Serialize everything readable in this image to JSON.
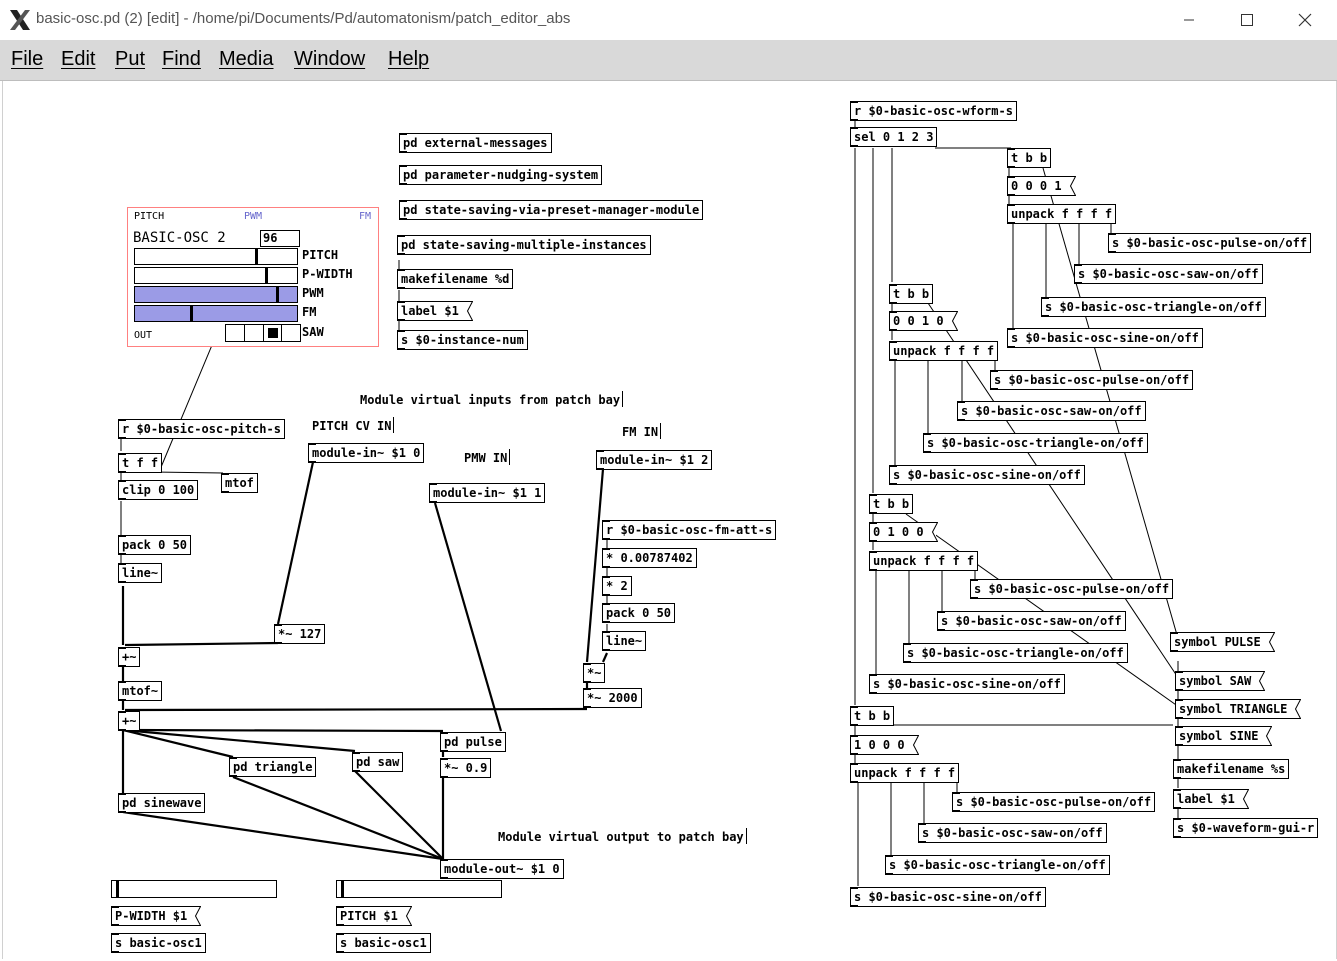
{
  "window": {
    "title": "basic-osc.pd  (2) [edit] - /home/pi/Documents/Pd/automatonism/patch_editor_abs",
    "icon": "x-window-icon",
    "controls": [
      "minimize-icon",
      "maximize-icon",
      "close-icon"
    ]
  },
  "menu": [
    "File",
    "Edit",
    "Put",
    "Find",
    "Media",
    "Window",
    "Help"
  ],
  "gui": {
    "top_labels": {
      "pitch": "PITCH",
      "pwm": "PWM",
      "fm": "FM"
    },
    "title": "BASIC-OSC 2",
    "number_box": "96",
    "rows": [
      "PITCH",
      "P-WIDTH",
      "PWM",
      "FM",
      "SAW"
    ],
    "out_label": "OUT",
    "slider_levels": [
      0.76,
      0.82,
      0.89,
      0.35
    ],
    "waveform_selected": 2,
    "colors": {
      "border": "#ff8080",
      "active_fill": "#9b9be6",
      "pwm_label": "#6666cc"
    }
  },
  "comments": {
    "inputs": "Module virtual inputs from patch bay",
    "pitch_cv": "PITCH CV IN",
    "pmw": "PMW IN",
    "fm": "FM IN",
    "output": "Module virtual output to patch bay"
  },
  "objects": {
    "ext_messages": "pd external-messages",
    "nudging": "pd parameter-nudging-system",
    "preset": "pd state-saving-via-preset-manager-module",
    "multi": "pd state-saving-multiple-instances",
    "mkfile1": "makefilename %d",
    "label1": "label $1",
    "instance": "s $0-instance-num",
    "pitch_r": "r $0-basic-osc-pitch-s",
    "tff": "t f f",
    "mtof1": "mtof",
    "clip": "clip 0 100",
    "pack1": "pack 0 50",
    "line1": "line~",
    "modin_pitch": "module-in~ $1 0",
    "mul127": "*~ 127",
    "add1": "+~",
    "mtof2": "mtof~",
    "add2": "+~",
    "modin_pwm": "module-in~ $1 1",
    "modin_fm": "module-in~ $1 2",
    "fm_att": "r $0-basic-osc-fm-att-s",
    "mul_small": "* 0.00787402",
    "mul2": "* 2",
    "pack2": "pack 0 50",
    "line2": "line~",
    "mulsig": "*~",
    "mul2000": "*~ 2000",
    "pd_triangle": "pd triangle",
    "pd_saw": "pd saw",
    "pd_pulse": "pd pulse",
    "mul09": "*~ 0.9",
    "pd_sinewave": "pd sinewave",
    "modout": "module-out~ $1 0",
    "pwidth_msg": "P-WIDTH $1",
    "s_osc1_a": "s basic-osc1",
    "pitch_msg": "PITCH $1",
    "s_osc1_b": "s basic-osc1",
    "wform_r": "r $0-basic-osc-wform-s",
    "sel": "sel 0 1 2 3",
    "tbb1": "t b b",
    "msg0001": "0 0 0 1",
    "unpack1": "unpack f f f f",
    "s_pulse1": "s $0-basic-osc-pulse-on/off",
    "s_saw1": "s $0-basic-osc-saw-on/off",
    "s_tri1": "s $0-basic-osc-triangle-on/off",
    "s_sine1": "s $0-basic-osc-sine-on/off",
    "tbb2": "t b b",
    "msg0010": "0 0 1 0",
    "unpack2": "unpack f f f f",
    "s_pulse2": "s $0-basic-osc-pulse-on/off",
    "s_saw2": "s $0-basic-osc-saw-on/off",
    "s_tri2": "s $0-basic-osc-triangle-on/off",
    "s_sine2": "s $0-basic-osc-sine-on/off",
    "tbb3": "t b b",
    "msg0100": "0 1 0 0",
    "unpack3": "unpack f f f f",
    "s_pulse3": "s $0-basic-osc-pulse-on/off",
    "s_saw3": "s $0-basic-osc-saw-on/off",
    "s_tri3": "s $0-basic-osc-triangle-on/off",
    "s_sine3": "s $0-basic-osc-sine-on/off",
    "tbb4": "t b b",
    "msg1000": "1 0 0 0",
    "unpack4": "unpack f f f f",
    "s_pulse4": "s $0-basic-osc-pulse-on/off",
    "s_saw4": "s $0-basic-osc-saw-on/off",
    "s_tri4": "s $0-basic-osc-triangle-on/off",
    "s_sine4": "s $0-basic-osc-sine-on/off",
    "sym_pulse": "symbol PULSE",
    "sym_saw": "symbol SAW",
    "sym_tri": "symbol TRIANGLE",
    "sym_sine": "symbol SINE",
    "mkfile2": "makefilename %s",
    "label2": "label $1",
    "s_wave_gui": "s $0-waveform-gui-r"
  }
}
